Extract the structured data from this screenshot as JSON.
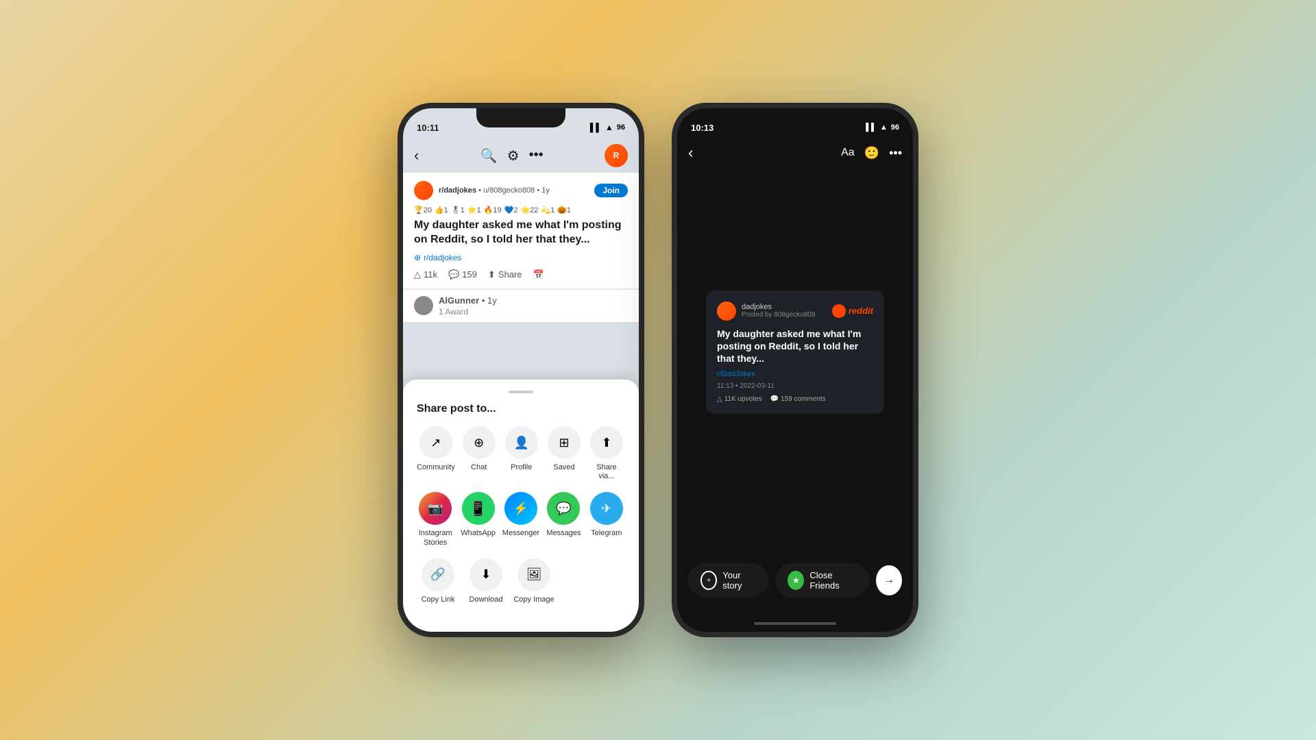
{
  "phone1": {
    "status": {
      "time": "10:11",
      "location_icon": "▶",
      "battery": "96"
    },
    "post": {
      "subreddit": "r/dadjokes",
      "user": "u/808gecko808",
      "time_ago": "1y",
      "join_label": "Join",
      "title": "My daughter asked me what I'm posting on Reddit, so I told her that they...",
      "subreddit_link": "r/dadjokes",
      "upvotes": "11k",
      "comments": "159",
      "share_label": "Share",
      "commenter": "AlGunner",
      "comment_time": "1y",
      "award_label": "1 Award"
    },
    "share_sheet": {
      "title": "Share post to...",
      "row1": [
        {
          "label": "Community",
          "icon": "↗",
          "type": "gray"
        },
        {
          "label": "Chat",
          "icon": "⊕",
          "type": "gray"
        },
        {
          "label": "Profile",
          "icon": "👤",
          "type": "gray"
        },
        {
          "label": "Saved",
          "icon": "⊞",
          "type": "gray"
        },
        {
          "label": "Share via...",
          "icon": "⬆",
          "type": "gray"
        }
      ],
      "row2": [
        {
          "label": "Instagram\nStories",
          "type": "ig"
        },
        {
          "label": "WhatsApp",
          "type": "wa"
        },
        {
          "label": "Messenger",
          "type": "msg"
        },
        {
          "label": "Messages",
          "type": "imsg"
        },
        {
          "label": "Telegram",
          "type": "tg"
        }
      ],
      "row3": [
        {
          "label": "Copy Link",
          "icon": "🔗",
          "type": "gray"
        },
        {
          "label": "Download",
          "icon": "⬇",
          "type": "gray"
        },
        {
          "label": "Copy Image",
          "icon": "🖼",
          "type": "gray"
        }
      ]
    }
  },
  "phone2": {
    "status": {
      "time": "10:13",
      "location_icon": "▶"
    },
    "header": {
      "text_btn": "Aa",
      "sticker_icon": "🙂",
      "more_icon": "•••"
    },
    "card": {
      "username": "dadjokes",
      "posted_by": "Posted by 808gecko808",
      "title": "My daughter asked me what I'm posting on Reddit, so I told her that they...",
      "subreddit": "r/DadJokes",
      "timestamp": "11:13 • 2022-03-11",
      "upvotes": "11K upvotes",
      "comments": "159 comments"
    },
    "bottom": {
      "your_story": "Your story",
      "close_friends": "Close Friends",
      "next_icon": "→"
    }
  }
}
